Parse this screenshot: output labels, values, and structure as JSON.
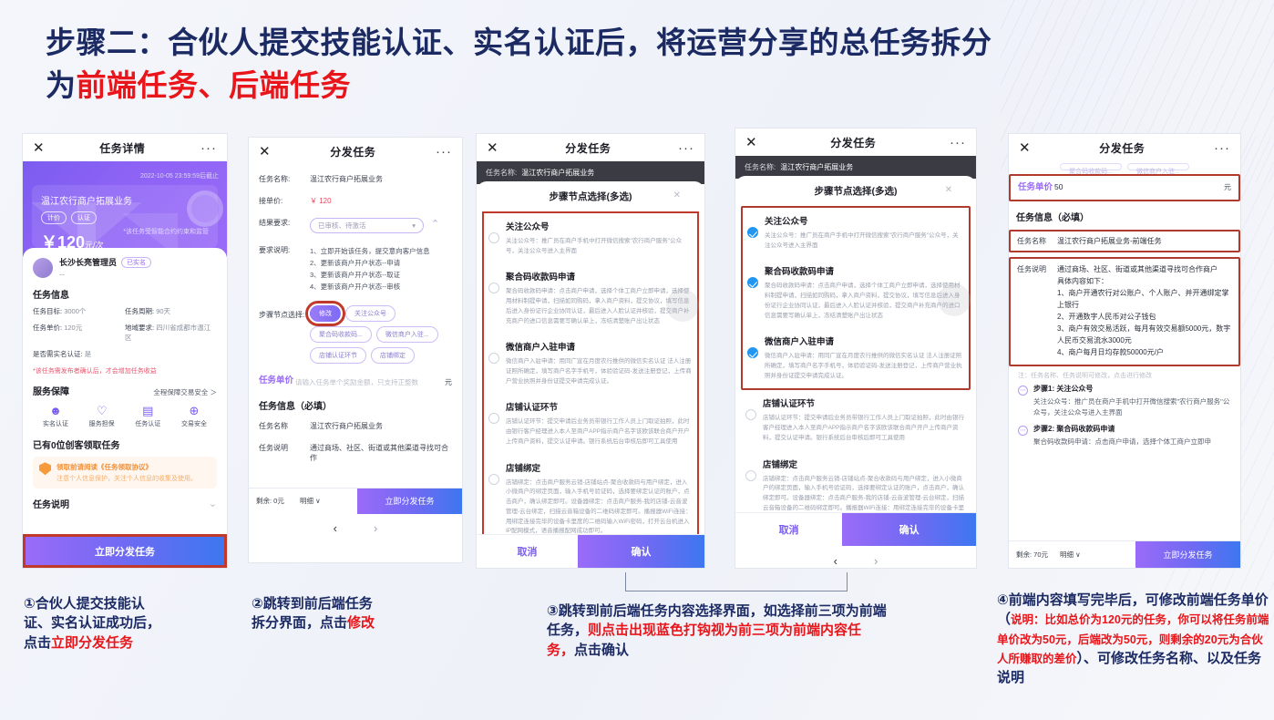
{
  "title": {
    "part1": "步骤二：合伙人提交技能认证、实名认证后，将运营分享的总任务拆分",
    "part2_prefix": "为",
    "part2_red": "前端任务、后端任务"
  },
  "phone1": {
    "header": {
      "close": "✕",
      "title": "任务详情",
      "more": "···"
    },
    "hero": {
      "deadline": "2022-10-05 23:59:59后截止",
      "name": "温江农行商户拓展业务",
      "tags": [
        "计价",
        "认证"
      ],
      "price": "￥120",
      "price_unit": "元/次",
      "note": "*该任务受智能合约约束和监管"
    },
    "user": {
      "name": "长沙长亮管理员",
      "badge": "已实名",
      "sub": "--"
    },
    "info_title": "任务信息",
    "info": [
      {
        "k": "任务目标:",
        "v": "3000个"
      },
      {
        "k": "任务周期:",
        "v": "90天"
      },
      {
        "k": "任务单价:",
        "v": "120元"
      },
      {
        "k": "地域要求:",
        "v": "四川省成都市温江区"
      },
      {
        "k": "是否需实名认证:",
        "v": "是"
      }
    ],
    "warning": "*该任务需发布者确认后，才会增加任务收益",
    "service_title": "服务保障",
    "service_more": "全程保障交易安全 ＞",
    "services": [
      {
        "icon": "person-icon",
        "glyph": "☻",
        "label": "实名认证"
      },
      {
        "icon": "heart-icon",
        "glyph": "♡",
        "label": "服务担保"
      },
      {
        "icon": "doc-icon",
        "glyph": "▤",
        "label": "任务认证"
      },
      {
        "icon": "shield-icon",
        "glyph": "⊕",
        "label": "交易安全"
      }
    ],
    "claimed": "已有0位创客领取任务",
    "tip": {
      "line1": "领取前请阅读《任务领取协议》",
      "line2": "注意个人信息保护，关注个人信息的收集及使用。"
    },
    "desc_title": "任务说明",
    "cta": "立即分发任务"
  },
  "phone2": {
    "header": {
      "close": "✕",
      "title": "分发任务",
      "more": "···"
    },
    "task_name_label": "任务名称:",
    "task_name_value": "温江农行商户拓展业务",
    "unit_label": "接单价:",
    "unit_value": "￥ 120",
    "result_label": "结果要求:",
    "result_value": "已审核、待激活",
    "req_label": "要求说明:",
    "reqs": [
      "1、立即开始该任务，提交意向客户信息",
      "2、更新该商户开户状态--申请",
      "3、更新该商户开户状态--取证",
      "4、更新该商户开户状态--审核"
    ],
    "node_label": "步骤节点选择:",
    "chips": [
      "修改",
      "关注公众号",
      "聚合码收款码...",
      "微信商户入驻...",
      "店铺认证环节",
      "店铺绑定"
    ],
    "price_label": "任务单价",
    "price_placeholder": "请输入任务单个奖励金额，只支持正整数",
    "price_unit": "元",
    "section_title": "任务信息（必填）",
    "name_label": "任务名称",
    "name_value": "温江农行商户拓展业务",
    "desc_label": "任务说明",
    "desc_value": "通过商场、社区、街道或其他渠道寻找可合作",
    "footer": {
      "remain": "剩余: 0元",
      "detail": "明细 ∨",
      "cta": "立即分发任务"
    },
    "pager": {
      "prev": "‹",
      "next": "›"
    }
  },
  "phone3": {
    "header": {
      "close": "✕",
      "title": "分发任务",
      "more": "···"
    },
    "dim_label": "任务名称:",
    "dim_value": "温江农行商户拓展业务",
    "modal_title": "步骤节点选择(多选)",
    "modal_close": "✕",
    "options": [
      {
        "title": "关注公众号",
        "checked": false,
        "desc": "关注公众号：推广员在商户手机中打开微信搜索\"农行商户服务\"公众号，关注公众号进入主界面"
      },
      {
        "title": "聚合码收款码申请",
        "checked": false,
        "desc": "聚合码收款码申请：点击商户申请，选择个体工商户立即申请，选择使用材料制提申请，扫描如同购码，拿入商户资料，提交协议，填写信息后进入身份证行企业协同认证，最后进入人脸认证并核验，提交商户补充商户的进口信息需要写确认单上，冻结清楚账户出让状态"
      },
      {
        "title": "微信商户入驻申请",
        "checked": false,
        "desc": "微信商户入驻申请：用同广宣在月度农行推供的微信实名认证 法人注册证照所确定，填写商户名字手机号，体验验证码-发送注册登记，上传商户营业执照并身份证提交申请完成认证。"
      },
      {
        "title": "店铺认证环节",
        "checked": false,
        "desc": "店铺认证环节：提交申请后业务员带银行工作人员上门取证拍照，此时由银行客户经理进入本人至商户APP指示商户名字该欧该联合商户开户上传商户资料，提交认证申请。银行系统后台审核后即可工具使用"
      },
      {
        "title": "店铺绑定",
        "checked": false,
        "desc": "店铺绑定：点击商户服务云销-店铺站点-聚合收款码与用户绑定，进入小微商户的绑定页面，输入手机号验证码，选择要绑定认证的账户，点击商户，确认绑定即可。设备器绑定：点击商户服务-我的店铺-云音波管理-云台绑定，扫描云音箱设备的二维码绑定即可。播报器WiFi连接：用绑定连接完毕的设备卡里度的二维码输入WiFi密码，打开云台机进入IP配网模式，语音播报配网成功即可。"
      }
    ],
    "cancel": "取消",
    "confirm": "确认"
  },
  "phone4": {
    "header": {
      "close": "✕",
      "title": "分发任务",
      "more": "···"
    },
    "dim_label": "任务名称:",
    "dim_value": "温江农行商户拓展业务",
    "modal_title": "步骤节点选择(多选)",
    "modal_close": "✕",
    "options": [
      {
        "title": "关注公众号",
        "checked": true,
        "desc": "关注公众号：推广员在商户手机中打开微信搜索\"农行商户服务\"公众号，关注公众号进入主界面"
      },
      {
        "title": "聚合码收款码申请",
        "checked": true,
        "desc": "聚合码收款码申请：点击商户申请，选择个体工商户立即申请，选择使用材料制提申请，扫描如同购码，拿入商户资料，提交协议，填写信息后进入身份证行企业协同认证，最后进入人脸认证并核验，提交商户补充商户的进口信息需要写确认单上，冻结清楚账户出让状态"
      },
      {
        "title": "微信商户入驻申请",
        "checked": true,
        "desc": "微信商户入驻申请：用同广宣在月度农行推供的微信实名认证 法人注册证照所确定，填写商户名字手机号，体验验证码-发送注册登记，上传商户营业执照并身份证提交申请完成认证。"
      },
      {
        "title": "店铺认证环节",
        "checked": false,
        "desc": "店铺认证环节：提交申请后业务员带银行工作人员上门取证拍照，此时由银行客户经理进入本人至商户APP指示商户名字该欧该联合商户开户上传商户资料，提交认证申请。银行系统后台审核后即可工具使用"
      },
      {
        "title": "店铺绑定",
        "checked": false,
        "desc": "店铺绑定：点击商户服务云销-店铺站点-聚合收款码与用户绑定，进入小微商户的绑定页面，输入手机号验证码，选择要绑定认证的账户，点击商户，确认绑定即可。设备器绑定：点击商户服务-我的店铺-云音波管理-云台绑定，扫描云音箱设备的二维码绑定即可。播报器WiFi连接：用绑定连接完毕的设备卡里度的二维码输入WiFi密码，打开云台机进入IP配网模式，语音播报配网成功即可。"
      }
    ],
    "cancel": "取消",
    "confirm": "确认",
    "pager": {
      "prev": "‹",
      "next": "›"
    }
  },
  "phone5": {
    "header": {
      "close": "✕",
      "title": "分发任务",
      "more": "···"
    },
    "top_chips": [
      "聚合码收款码...",
      "微信商户入驻..."
    ],
    "price_label": "任务单价",
    "price_value": "50",
    "price_unit": "元",
    "section_title": "任务信息（必填）",
    "name_label": "任务名称",
    "name_value": "温江农行商户拓展业务-前端任务",
    "desc_label": "任务说明",
    "desc_lines": [
      "通过商场、社区、街道或其他渠道寻找可合作商户",
      "具体内容如下：",
      "1、商户开通农行对公账户、个人账户、并开通绑定掌上银行",
      "2、开通数字人民币对公子钱包",
      "3、商户有效交易活跃，每月有效交易额5000元，数字人民币交易流水3000元",
      "4、商户每月日均存款50000元/户"
    ],
    "note": "注：任务名称、任务说明可修改，点击进行修改",
    "steps": [
      {
        "title": "步骤1: 关注公众号",
        "desc": "关注公众号：推广员在商户手机中打开微信搜索\"农行商户服务\"公众号，关注公众号进入主界面"
      },
      {
        "title": "步骤2: 聚合码收款码申请",
        "desc": "聚合码收款码申请：点击商户申请，选择个体工商户立即申"
      }
    ],
    "footer": {
      "remain": "剩余: 70元",
      "detail": "明细 ∨",
      "cta": "立即分发任务"
    }
  },
  "captions": {
    "c1": {
      "l1": "①合伙人提交技能认",
      "l2": "证、实名认证成功后，",
      "l3_prefix": "点击",
      "l3_red": "立即分发任务"
    },
    "c2": {
      "l1": "②跳转到前后端任务",
      "l2_prefix": "拆分界面，点击",
      "l2_red": "修改"
    },
    "c3": {
      "p1": "③跳转到前后端任务内容选择界面，如选择前三项为前端任务，",
      "red": "则点击出现蓝色打钩视为前三项为前端内容任务，",
      "p2": "点击确认"
    },
    "c4": {
      "p1": "④前端内容填写完毕后，可修改前端任务单价（",
      "red": "说明：比如总价为120元的任务，你可以将任务前端单价改为50元，后端改为50元，则剩余的20元为合伙人所赚取的差价",
      "p2": "）、可修改任务名称、以及任务说明"
    }
  },
  "colors": {
    "accent": "#7b5cf0",
    "red": "#e8161a",
    "navy": "#1b2a63",
    "check": "#2196f3",
    "boxRed": "#b03a2e"
  }
}
